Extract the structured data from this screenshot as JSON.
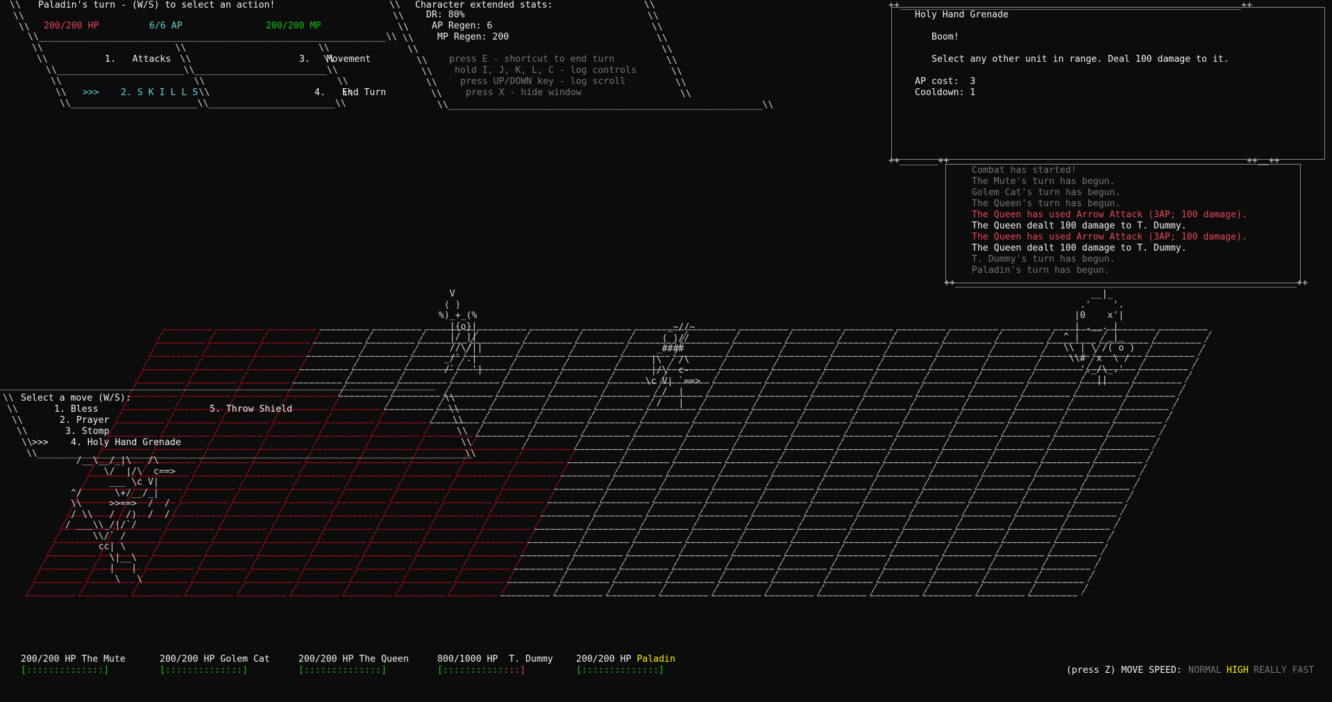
{
  "action_panel": {
    "turn_prompt": "Paladin's turn - (W/S) to select an action!",
    "hp": "200/200 HP",
    "ap": "6/6 AP",
    "mp": "200/200 MP",
    "menu": {
      "attacks": "1.   Attacks",
      "movement": "3.   Movement",
      "skills_cursor": ">>>",
      "skills": "2. S K I L L S",
      "end_turn": "4.   End Turn"
    }
  },
  "stats_panel": {
    "title": "Character extended stats:",
    "dr": "DR: 80%",
    "ap_regen": "AP Regen: 6",
    "mp_regen": "MP Regen: 200",
    "hints": [
      "press E - shortcut to end turn",
      "hold I, J, K, L, C - log controls",
      "press UP/DOWN key - log scroll",
      "press X - hide window"
    ]
  },
  "skill_info": {
    "name": "Holy Hand Grenade",
    "flavor": "Boom!",
    "description": "Select any other unit in range. Deal 100 damage to it.",
    "ap_cost": "AP cost:  3",
    "cooldown": "Cooldown: 1"
  },
  "combat_log": [
    {
      "text": "Combat has started!",
      "style": "dim"
    },
    {
      "text": "The Mute's turn has begun.",
      "style": "dim"
    },
    {
      "text": "Golem Cat's turn has begun.",
      "style": "dim"
    },
    {
      "text": "The Queen's turn has begun.",
      "style": "dim"
    },
    {
      "text": "The Queen has used Arrow Attack (3AP; 100 damage).",
      "style": "red"
    },
    {
      "text": "The Queen dealt 100 damage to T. Dummy.",
      "style": "white"
    },
    {
      "text": "The Queen has used Arrow Attack (3AP; 100 damage).",
      "style": "red"
    },
    {
      "text": "The Queen dealt 100 damage to T. Dummy.",
      "style": "white"
    },
    {
      "text": "T. Dummy's turn has begun.",
      "style": "dim"
    },
    {
      "text": "Paladin's turn has begun.",
      "style": "dim"
    }
  ],
  "move_menu": {
    "title": "Select a move (W/S):",
    "cursor": ">>>",
    "moves": [
      "1. Bless",
      "2. Prayer",
      "3. Stomp",
      "4. Holy Hand Grenade",
      "5. Throw Shield"
    ],
    "selected_index": 3
  },
  "units": [
    {
      "hp_text": "200/200 HP",
      "name": "The Mute",
      "hp_fraction": 1.0,
      "bar": "[::::::::::::::]"
    },
    {
      "hp_text": "200/200 HP",
      "name": "Golem Cat",
      "hp_fraction": 1.0,
      "bar": "[::::::::::::::]"
    },
    {
      "hp_text": "200/200 HP",
      "name": "The Queen",
      "hp_fraction": 1.0,
      "bar": "[::::::::::::::]"
    },
    {
      "hp_text": "800/1000 HP",
      "name": "T. Dummy",
      "hp_fraction": 0.8,
      "bar_full": "[:::::::::::",
      "bar_empty": ":::]"
    },
    {
      "hp_text": "200/200 HP",
      "name": "Paladin",
      "hp_fraction": 1.0,
      "bar": "[::::::::::::::]"
    }
  ],
  "move_speed": {
    "label": "(press Z) MOVE SPEED:",
    "options": [
      "NORMAL",
      "HIGH",
      "REALLY FAST"
    ],
    "selected": "HIGH"
  },
  "sprites": {
    "queen": "    V\n   ( )\n  %)_+_(%\n    |{o}|\n    |/ ||\n    //\\/||\n   _/` .|\n   /`   '|",
    "golem_cat": "        _~//~\n       ( )//\n      _####\n     |\\   /\\\n     |/\\  c-\n    \\c V| `==>\n       /  |\n      /   |",
    "dummy": "     __|_\n   .'    '.\n  |0    x'|\n  | .__. |\n^ |     _|_\n\\\\ | \\ /( o )\n \\\\#  x  \\ /\n   '._/\\_.'\n      ||",
    "mute": "  /__\\__/_|\\   /\\\n       \\/  |/\\  c==>\n        ___ \\c V|\n ^/      \\+/__/_|\n \\\\     >>==>  /  /\n / \\\\   /  /)  /  /\n/ ___\\\\_/|/`/\n     \\\\/` /\n      cc| \\\n        \\|__\\\n        |   |\n         \\   \\"
  },
  "colors": {
    "background": "#0c0c0c",
    "text": "#d4d4d4",
    "hp": "#e74856",
    "ap": "#61d6d6",
    "mp": "#16c60c",
    "dim": "#767676",
    "grid": "#cccccc",
    "grid_red": "#c50f1f",
    "highlight": "#f9f100"
  }
}
